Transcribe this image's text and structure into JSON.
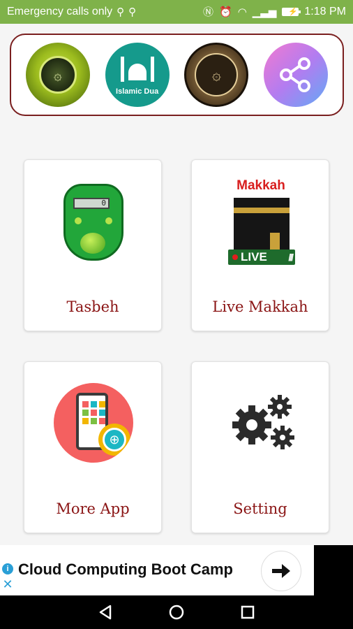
{
  "status_bar": {
    "carrier_text": "Emergency calls only",
    "time": "1:18 PM"
  },
  "top_strip": {
    "items": [
      {
        "name": "quran-app-1"
      },
      {
        "name": "islamic-dua",
        "label": "Islamic Dua"
      },
      {
        "name": "quran-app-2"
      },
      {
        "name": "share"
      }
    ]
  },
  "tiles": [
    {
      "label": "Tasbeh",
      "icon": "tasbeh-counter-icon",
      "counter_value": "0"
    },
    {
      "label": "Live Makkah",
      "icon": "makkah-live-icon",
      "image_title": "Makkah",
      "badge": "LIVE"
    },
    {
      "label": "More App",
      "icon": "more-app-icon"
    },
    {
      "label": "Setting",
      "icon": "gears-icon"
    }
  ],
  "ad": {
    "title": "Cloud Computing Boot Camp"
  },
  "colors": {
    "status_bar": "#7fb24a",
    "tile_label": "#8a1414",
    "strip_border": "#7a1f1f",
    "makkah_title": "#d81e1e"
  }
}
